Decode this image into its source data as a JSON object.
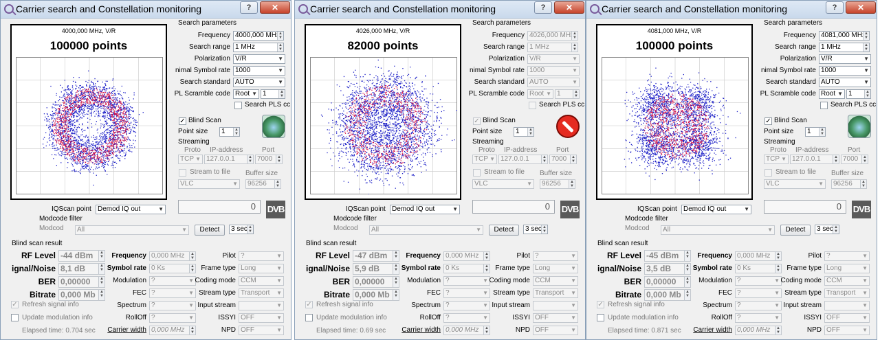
{
  "common": {
    "title": "Carrier search and Constellation monitoring",
    "help": "?",
    "close": "✕",
    "search_params_title": "Search parameters",
    "frequency_label": "Frequency",
    "search_range_label": "Search range",
    "polarization_label": "Polarization",
    "symbol_rate_label": "nimal Symbol rate",
    "search_standard_label": "Search standard",
    "pl_scramble_label": "PL Scramble code",
    "search_pls_label": "Search PLS cc",
    "blind_scan_label": "Blind Scan",
    "point_size_label": "Point size",
    "streaming_label": "Streaming",
    "proto_label": "Proto",
    "ip_label": "IP-address",
    "port_label": "Port",
    "stream_to_file_label": "Stream to file",
    "buffer_size_label": "Buffer size",
    "iqscan_label": "IQScan point",
    "iqscan_value": "Demod IQ out",
    "modcode_filter_label": "Modcode filter",
    "modcode_label": "Modcod",
    "modcode_value": "All",
    "detect_label": "Detect",
    "sec_value": "3 sec",
    "blind_result_title": "Blind scan result",
    "rf_level_label": "RF Level",
    "signal_noise_label": "ignal/Noise",
    "ber_label": "BER",
    "bitrate_label": "Bitrate",
    "frequency_r_label": "Frequency",
    "symbol_rate_r_label": "Symbol rate",
    "modulation_label": "Modulation",
    "fec_label": "FEC",
    "spectrum_label": "Spectrum",
    "rolloff_label": "RollOff",
    "carrier_width_label": "Carrier width",
    "pilot_label": "Pilot",
    "frame_type_label": "Frame type",
    "coding_mode_label": "Coding mode",
    "stream_type_label": "Stream type",
    "input_stream_label": "Input stream",
    "issyi_label": "ISSYI",
    "npd_label": "NPD",
    "refresh_label": "Refresh signal info",
    "update_mod_label": "Update modulation info",
    "ber_value": "0,00000",
    "bitrate_value": "0,000 Mb",
    "freq_result_value": "0,000 MHz",
    "symrate_result_value": "0 Ks",
    "carrier_width_value": "0,000 MHz",
    "q": "?",
    "pilot_value": "?",
    "frame_type_value": "Long",
    "coding_mode_value": "CCM",
    "stream_type_value": "Transport",
    "issyi_value": "OFF",
    "npd_value": "OFF",
    "search_range_value": "1 MHz",
    "polarization_value": "V/R",
    "symbol_rate_value": "1000",
    "search_standard_value": "AUTO",
    "pl_scramble_value": "Root",
    "pl_scramble_num": "1",
    "point_size_value": "1",
    "proto_value": "TCP",
    "ip_value": "127.0.0.1",
    "port_value": "7000",
    "vlc_value": "VLC",
    "buffer_value": "96256",
    "lcd_value": "0",
    "dvb_logo": "DVB",
    "check_mark": "✓"
  },
  "windows": [
    {
      "plot_frequency": "4000,000 MHz, V/R",
      "plot_points": "100000 points",
      "frequency_value": "4000,000 MHz",
      "rf_level": "-44 dBm",
      "signal_noise": "8,1 dB",
      "elapsed": "Elapsed time: 0.704 sec",
      "scanning": false,
      "shape": "ring"
    },
    {
      "plot_frequency": "4026,000 MHz, V/R",
      "plot_points": "82000 points",
      "frequency_value": "4026,000 MHz",
      "rf_level": "-47 dBm",
      "signal_noise": "5,9 dB",
      "elapsed": "Elapsed time: 0.69 sec",
      "scanning": true,
      "shape": "blob"
    },
    {
      "plot_frequency": "4081,000 MHz, V/R",
      "plot_points": "100000 points",
      "frequency_value": "4081,000 MHz",
      "rf_level": "-45 dBm",
      "signal_noise": "3,5 dB",
      "elapsed": "Elapsed time: 0.871 sec",
      "scanning": false,
      "shape": "square"
    }
  ]
}
